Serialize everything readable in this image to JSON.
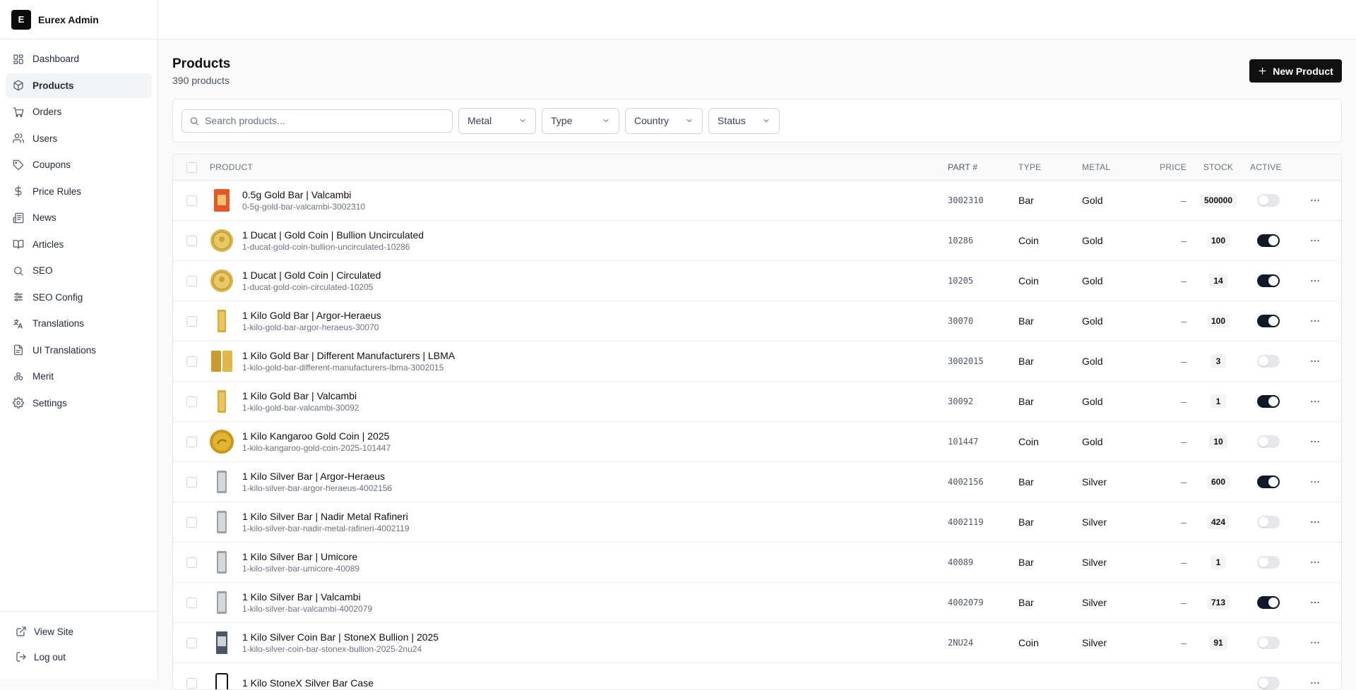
{
  "brand": {
    "logo_letter": "E",
    "name": "Eurex Admin"
  },
  "nav": [
    {
      "label": "Dashboard",
      "icon": "dashboard-icon",
      "active": false
    },
    {
      "label": "Products",
      "icon": "package-icon",
      "active": true
    },
    {
      "label": "Orders",
      "icon": "cart-icon",
      "active": false
    },
    {
      "label": "Users",
      "icon": "users-icon",
      "active": false
    },
    {
      "label": "Coupons",
      "icon": "tag-icon",
      "active": false
    },
    {
      "label": "Price Rules",
      "icon": "dollar-icon",
      "active": false
    },
    {
      "label": "News",
      "icon": "newspaper-icon",
      "active": false
    },
    {
      "label": "Articles",
      "icon": "book-icon",
      "active": false
    },
    {
      "label": "SEO",
      "icon": "search-icon",
      "active": false
    },
    {
      "label": "SEO Config",
      "icon": "sliders-icon",
      "active": false
    },
    {
      "label": "Translations",
      "icon": "languages-icon",
      "active": false
    },
    {
      "label": "UI Translations",
      "icon": "file-text-icon",
      "active": false
    },
    {
      "label": "Merit",
      "icon": "merit-icon",
      "active": false
    },
    {
      "label": "Settings",
      "icon": "gear-icon",
      "active": false
    }
  ],
  "bottom_nav": {
    "view_site": "View Site",
    "logout": "Log out"
  },
  "page": {
    "title": "Products",
    "subtitle": "390 products",
    "new_button": "New Product"
  },
  "filters": {
    "search_placeholder": "Search products...",
    "metal": "Metal",
    "type": "Type",
    "country": "Country",
    "status": "Status"
  },
  "table": {
    "columns": {
      "product": "Product",
      "part": "Part #",
      "type": "Type",
      "metal": "Metal",
      "price": "Price",
      "stock": "Stock",
      "active": "Active"
    },
    "rows": [
      {
        "name": "0.5g Gold Bar | Valcambi",
        "slug": "0-5g-gold-bar-valcambi-3002310",
        "part": "3002310",
        "type": "Bar",
        "metal": "Gold",
        "price": "–",
        "stock": "500000",
        "active": false,
        "thumb": "gold-card-bar"
      },
      {
        "name": "1 Ducat | Gold Coin | Bullion Uncirculated",
        "slug": "1-ducat-gold-coin-bullion-uncirculated-10286",
        "part": "10286",
        "type": "Coin",
        "metal": "Gold",
        "price": "–",
        "stock": "100",
        "active": true,
        "thumb": "gold-coin"
      },
      {
        "name": "1 Ducat | Gold Coin | Circulated",
        "slug": "1-ducat-gold-coin-circulated-10205",
        "part": "10205",
        "type": "Coin",
        "metal": "Gold",
        "price": "–",
        "stock": "14",
        "active": true,
        "thumb": "gold-coin"
      },
      {
        "name": "1 Kilo Gold Bar | Argor-Heraeus",
        "slug": "1-kilo-gold-bar-argor-heraeus-30070",
        "part": "30070",
        "type": "Bar",
        "metal": "Gold",
        "price": "–",
        "stock": "100",
        "active": true,
        "thumb": "gold-bar"
      },
      {
        "name": "1 Kilo Gold Bar | Different Manufacturers | LBMA",
        "slug": "1-kilo-gold-bar-different-manufacturers-lbma-3002015",
        "part": "3002015",
        "type": "Bar",
        "metal": "Gold",
        "price": "–",
        "stock": "3",
        "active": false,
        "thumb": "gold-bars"
      },
      {
        "name": "1 Kilo Gold Bar | Valcambi",
        "slug": "1-kilo-gold-bar-valcambi-30092",
        "part": "30092",
        "type": "Bar",
        "metal": "Gold",
        "price": "–",
        "stock": "1",
        "active": true,
        "thumb": "gold-bar"
      },
      {
        "name": "1 Kilo Kangaroo Gold Coin | 2025",
        "slug": "1-kilo-kangaroo-gold-coin-2025-101447",
        "part": "101447",
        "type": "Coin",
        "metal": "Gold",
        "price": "–",
        "stock": "10",
        "active": false,
        "thumb": "kangaroo-coin"
      },
      {
        "name": "1 Kilo Silver Bar | Argor-Heraeus",
        "slug": "1-kilo-silver-bar-argor-heraeus-4002156",
        "part": "4002156",
        "type": "Bar",
        "metal": "Silver",
        "price": "–",
        "stock": "600",
        "active": true,
        "thumb": "silver-bar"
      },
      {
        "name": "1 Kilo Silver Bar | Nadir Metal Rafineri",
        "slug": "1-kilo-silver-bar-nadir-metal-rafineri-4002119",
        "part": "4002119",
        "type": "Bar",
        "metal": "Silver",
        "price": "–",
        "stock": "424",
        "active": false,
        "thumb": "silver-bar"
      },
      {
        "name": "1 Kilo Silver Bar | Umicore",
        "slug": "1-kilo-silver-bar-umicore-40089",
        "part": "40089",
        "type": "Bar",
        "metal": "Silver",
        "price": "–",
        "stock": "1",
        "active": false,
        "thumb": "silver-bar"
      },
      {
        "name": "1 Kilo Silver Bar | Valcambi",
        "slug": "1-kilo-silver-bar-valcambi-4002079",
        "part": "4002079",
        "type": "Bar",
        "metal": "Silver",
        "price": "–",
        "stock": "713",
        "active": true,
        "thumb": "silver-bar"
      },
      {
        "name": "1 Kilo Silver Coin Bar | StoneX Bullion | 2025",
        "slug": "1-kilo-silver-coin-bar-stonex-bullion-2025-2nu24",
        "part": "2NU24",
        "type": "Coin",
        "metal": "Silver",
        "price": "–",
        "stock": "91",
        "active": false,
        "thumb": "silver-coinbar"
      },
      {
        "name": "1 Kilo StoneX Silver Bar Case",
        "slug": "",
        "part": "",
        "type": "",
        "metal": "",
        "price": "",
        "stock": "",
        "active": false,
        "thumb": "silver-case"
      }
    ]
  },
  "colors": {
    "primary": "#111111",
    "toggle_on": "#111827",
    "toggle_off": "#e5e7eb",
    "gold": "#c9a227",
    "silver": "#9ca3af"
  }
}
